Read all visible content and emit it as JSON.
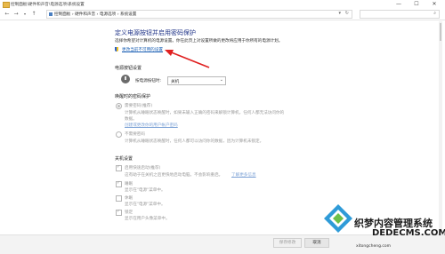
{
  "window": {
    "title": "控制面板\\硬件和声音\\电源选项\\系统设置",
    "minimize": "—",
    "maximize": "☐",
    "close": "✕"
  },
  "address": {
    "crumbs": "控制面板  ›  硬件和声音  ›  电源选项  ›  系统设置",
    "search_placeholder": ""
  },
  "page": {
    "heading": "定义电源按钮并启用密码保护",
    "description": "选择你希望对计算机的电源设置。你在此页上对设置所做的更改将应用于你所有的电源计划。",
    "change_link": "更改当前不可用的设置"
  },
  "power_button": {
    "section_title": "电源按钮设置",
    "label": "按电源按钮时:",
    "value": "关机"
  },
  "wake_password": {
    "section_title": "唤醒时的密码保护",
    "option1_title": "需要密码(推荐)",
    "option1_desc1": "计算机从睡眠状态唤醒时，如果未输入正确的密码来解锁计算机，任何人都无法访问你的",
    "option1_desc2": "数据。",
    "option1_link": "创建或更改你的用户帐户密码",
    "option2_title": "不需要密码",
    "option2_desc": "计算机从睡眠状态唤醒时，任何人都可以访问你的数据，因为计算机未锁定。"
  },
  "shutdown": {
    "section_title": "关机设置",
    "fast_startup": "启用快速启动(推荐)",
    "fast_startup_desc": "这有助于在关机之后更快地启动电脑。不会影响重启。",
    "learn_more": "了解更多信息",
    "sleep": "睡眠",
    "sleep_desc": "显示在\"电源\"菜单中。",
    "hibernate": "休眠",
    "hibernate_desc": "显示在\"电源\"菜单中。",
    "lock": "锁定",
    "lock_desc": "显示在用户头像菜单中。"
  },
  "footer": {
    "save": "保存修改",
    "cancel": "取消"
  },
  "watermark": {
    "line1": "织梦内容管理系统",
    "line2": "DEDECMS.COM",
    "line3": "xitongcheng.com"
  },
  "colors": {
    "heading": "#1e3287",
    "link": "#1a5fb4",
    "annotation_arrow": "#e02020"
  },
  "icons": {
    "shield": "shield-icon",
    "power": "power-icon"
  }
}
